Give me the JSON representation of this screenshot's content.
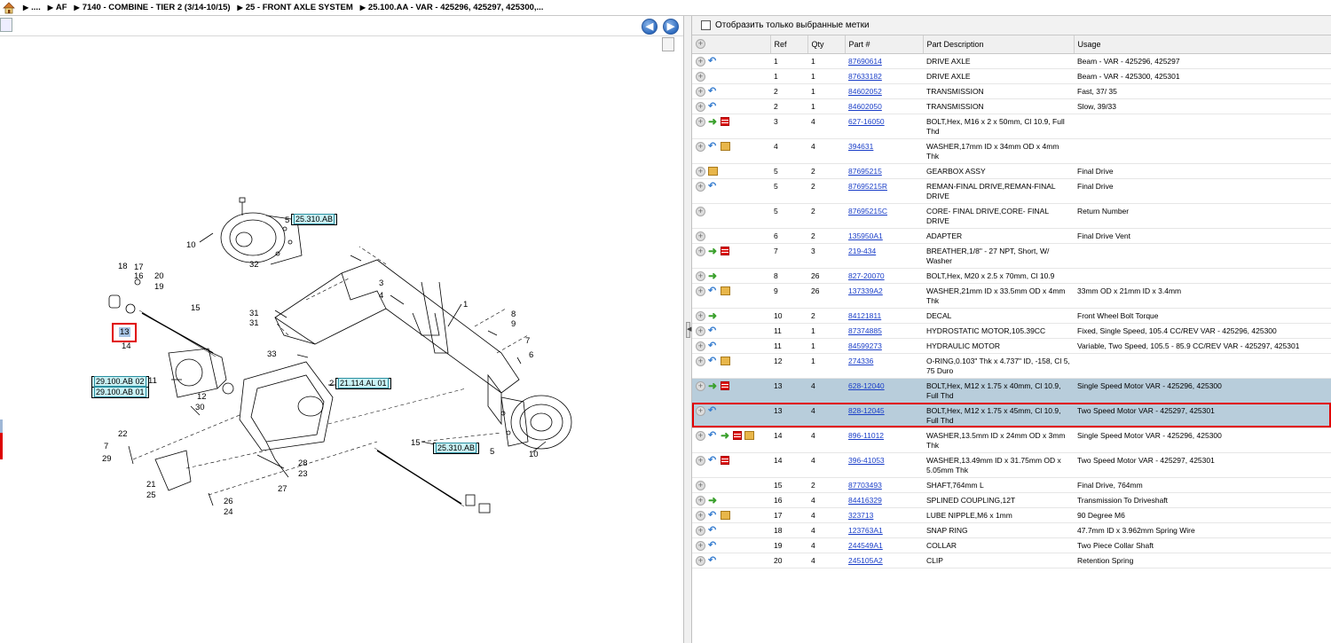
{
  "breadcrumb": [
    "....",
    "AF",
    "7140 - COMBINE - TIER 2 (3/14-10/15)",
    "25 - FRONT AXLE SYSTEM",
    "25.100.AA - VAR - 425296, 425297, 425300,..."
  ],
  "filter": {
    "label": "Отобразить только выбранные метки"
  },
  "table": {
    "columns": [
      "Ref",
      "Qty",
      "Part #",
      "Part Description",
      "Usage"
    ],
    "rows": [
      {
        "icons": [
          "blue"
        ],
        "ref": "1",
        "qty": "1",
        "part": "87690614",
        "desc": "DRIVE AXLE",
        "usage": "Beam - VAR - 425296, 425297"
      },
      {
        "icons": [],
        "ref": "1",
        "qty": "1",
        "part": "87633182",
        "desc": "DRIVE AXLE",
        "usage": "Beam - VAR - 425300, 425301"
      },
      {
        "icons": [
          "blue"
        ],
        "ref": "2",
        "qty": "1",
        "part": "84602052",
        "desc": "TRANSMISSION",
        "usage": "Fast, 37/ 35"
      },
      {
        "icons": [
          "blue"
        ],
        "ref": "2",
        "qty": "1",
        "part": "84602050",
        "desc": "TRANSMISSION",
        "usage": "Slow, 39/33"
      },
      {
        "icons": [
          "green",
          "red"
        ],
        "ref": "3",
        "qty": "4",
        "part": "627-16050",
        "desc": "BOLT,Hex, M16 x 2 x 50mm, Cl 10.9, Full Thd",
        "usage": ""
      },
      {
        "icons": [
          "blue",
          "box"
        ],
        "ref": "4",
        "qty": "4",
        "part": "394631",
        "desc": "WASHER,17mm ID x 34mm OD x 4mm Thk",
        "usage": ""
      },
      {
        "icons": [
          "box"
        ],
        "ref": "5",
        "qty": "2",
        "part": "87695215",
        "desc": "GEARBOX ASSY",
        "usage": "Final Drive"
      },
      {
        "icons": [
          "blue"
        ],
        "ref": "5",
        "qty": "2",
        "part": "87695215R",
        "desc": "REMAN-FINAL DRIVE,REMAN-FINAL DRIVE",
        "usage": "Final Drive"
      },
      {
        "icons": [],
        "ref": "5",
        "qty": "2",
        "part": "87695215C",
        "desc": "CORE- FINAL DRIVE,CORE- FINAL DRIVE",
        "usage": "Return Number"
      },
      {
        "icons": [],
        "ref": "6",
        "qty": "2",
        "part": "135950A1",
        "desc": "ADAPTER",
        "usage": "Final Drive Vent"
      },
      {
        "icons": [
          "green",
          "red"
        ],
        "ref": "7",
        "qty": "3",
        "part": "219-434",
        "desc": "BREATHER,1/8\" - 27 NPT, Short, W/ Washer",
        "usage": ""
      },
      {
        "icons": [
          "green"
        ],
        "ref": "8",
        "qty": "26",
        "part": "827-20070",
        "desc": "BOLT,Hex, M20 x 2.5 x 70mm, Cl 10.9",
        "usage": ""
      },
      {
        "icons": [
          "blue",
          "box"
        ],
        "ref": "9",
        "qty": "26",
        "part": "137339A2",
        "desc": "WASHER,21mm ID x 33.5mm OD x 4mm Thk",
        "usage": "33mm OD x 21mm ID x 3.4mm"
      },
      {
        "icons": [
          "green"
        ],
        "ref": "10",
        "qty": "2",
        "part": "84121811",
        "desc": "DECAL",
        "usage": "Front Wheel Bolt Torque"
      },
      {
        "icons": [
          "blue"
        ],
        "ref": "11",
        "qty": "1",
        "part": "87374885",
        "desc": "HYDROSTATIC MOTOR,105.39CC",
        "usage": "Fixed, Single Speed, 105.4 CC/REV VAR - 425296, 425300"
      },
      {
        "icons": [
          "blue"
        ],
        "ref": "11",
        "qty": "1",
        "part": "84599273",
        "desc": "HYDRAULIC MOTOR",
        "usage": "Variable, Two Speed, 105.5 - 85.9 CC/REV VAR - 425297, 425301"
      },
      {
        "icons": [
          "blue",
          "box"
        ],
        "ref": "12",
        "qty": "1",
        "part": "274336",
        "desc": "O-RING,0.103\" Thk x 4.737\" ID, -158, Cl 5, 75 Duro",
        "usage": ""
      },
      {
        "icons": [
          "green",
          "red"
        ],
        "ref": "13",
        "qty": "4",
        "part": "628-12040",
        "desc": "BOLT,Hex, M12 x 1.75 x 40mm, Cl 10.9, Full Thd",
        "usage": "Single Speed Motor VAR - 425296, 425300",
        "sel": true
      },
      {
        "icons": [
          "blue"
        ],
        "ref": "13",
        "qty": "4",
        "part": "828-12045",
        "desc": "BOLT,Hex, M12 x 1.75 x 45mm, Cl 10.9, Full Thd",
        "usage": "Two Speed Motor VAR - 425297, 425301",
        "sel": true
      },
      {
        "icons": [
          "blue",
          "green",
          "red",
          "box"
        ],
        "ref": "14",
        "qty": "4",
        "part": "896-11012",
        "desc": "WASHER,13.5mm ID x 24mm OD x 3mm Thk",
        "usage": "Single Speed Motor VAR - 425296, 425300"
      },
      {
        "icons": [
          "blue",
          "red"
        ],
        "ref": "14",
        "qty": "4",
        "part": "396-41053",
        "desc": "WASHER,13.49mm ID x 31.75mm OD x 5.05mm Thk",
        "usage": "Two Speed Motor VAR - 425297, 425301"
      },
      {
        "icons": [],
        "ref": "15",
        "qty": "2",
        "part": "87703493",
        "desc": "SHAFT,764mm L",
        "usage": "Final Drive, 764mm"
      },
      {
        "icons": [
          "green"
        ],
        "ref": "16",
        "qty": "4",
        "part": "84416329",
        "desc": "SPLINED COUPLING,12T",
        "usage": "Transmission To Driveshaft"
      },
      {
        "icons": [
          "blue",
          "box"
        ],
        "ref": "17",
        "qty": "4",
        "part": "323713",
        "desc": "LUBE NIPPLE,M6 x 1mm",
        "usage": "90 Degree M6"
      },
      {
        "icons": [
          "blue"
        ],
        "ref": "18",
        "qty": "4",
        "part": "123763A1",
        "desc": "SNAP RING",
        "usage": "47.7mm ID x 3.962mm Spring Wire"
      },
      {
        "icons": [
          "blue"
        ],
        "ref": "19",
        "qty": "4",
        "part": "244549A1",
        "desc": "COLLAR",
        "usage": "Two Piece Collar Shaft"
      },
      {
        "icons": [
          "blue"
        ],
        "ref": "20",
        "qty": "4",
        "part": "245105A2",
        "desc": "CLIP",
        "usage": "Retention Spring"
      }
    ]
  },
  "diagram": {
    "callouts": [
      "1",
      "2",
      "3",
      "4",
      "5",
      "5",
      "6",
      "7",
      "7",
      "8",
      "9",
      "10",
      "10",
      "11",
      "12",
      "13",
      "14",
      "15",
      "15",
      "16",
      "17",
      "18",
      "19",
      "20",
      "21",
      "22",
      "23",
      "24",
      "25",
      "26",
      "27",
      "28",
      "29",
      "30",
      "31",
      "32",
      "33"
    ],
    "refs": [
      "25.310.AB",
      "25.310.AB",
      "29.100.AB 02",
      "29.100.AB 01",
      "21.114.AL 01"
    ]
  },
  "colors": {
    "link": "#1a3ec8",
    "selected_row": "#b8cddb",
    "highlight": "#e00000",
    "ref_fill": "#c9f1f4"
  }
}
